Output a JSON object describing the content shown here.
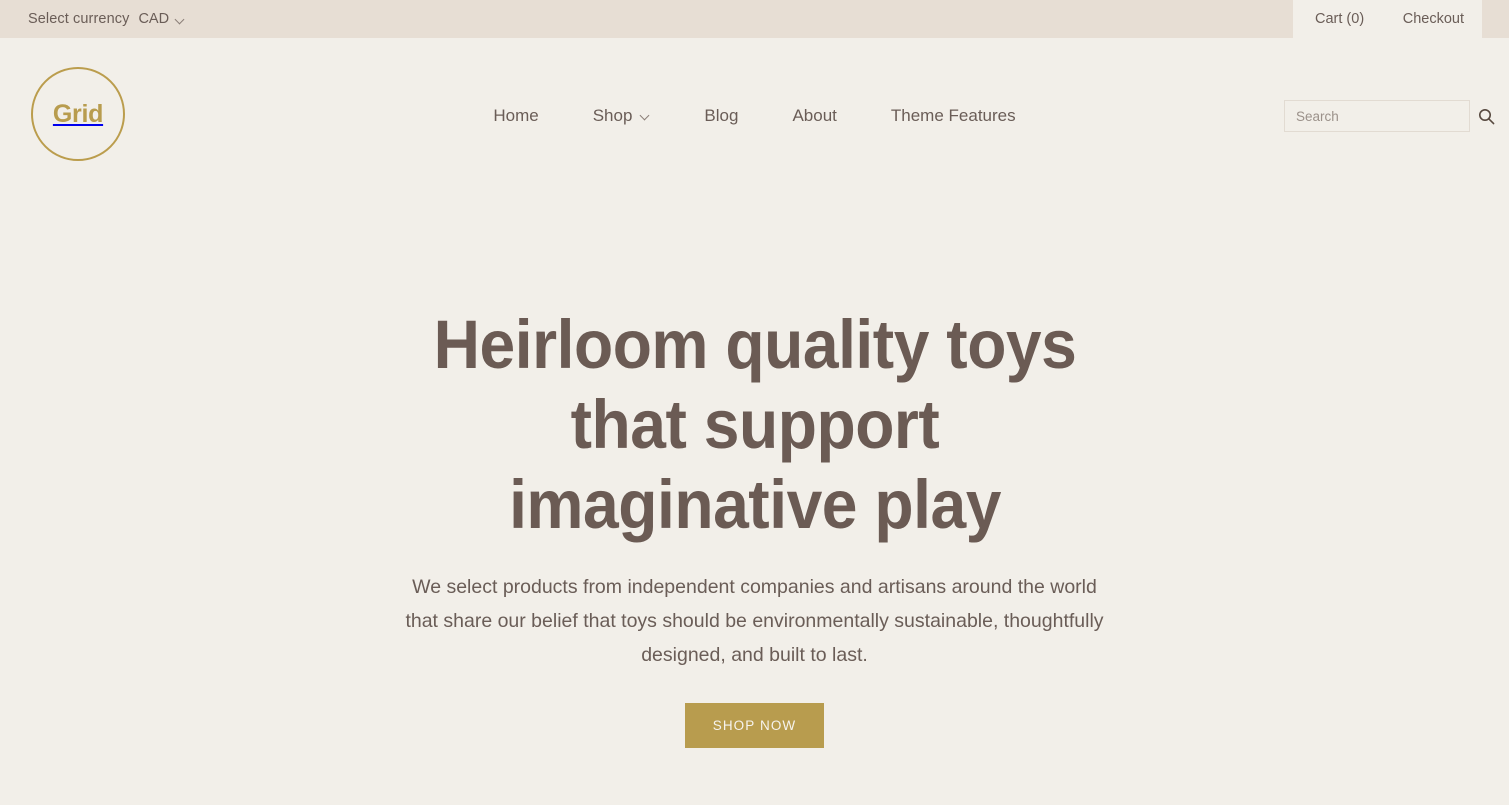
{
  "topbar": {
    "currency_label": "Select currency",
    "currency_value": "CAD",
    "cart_label": "Cart (0)",
    "checkout_label": "Checkout"
  },
  "header": {
    "logo_text": "Grid",
    "nav": [
      {
        "label": "Home",
        "has_dropdown": false
      },
      {
        "label": "Shop",
        "has_dropdown": true
      },
      {
        "label": "Blog",
        "has_dropdown": false
      },
      {
        "label": "About",
        "has_dropdown": false
      },
      {
        "label": "Theme Features",
        "has_dropdown": false
      }
    ],
    "search": {
      "value": "",
      "placeholder": "Search"
    }
  },
  "hero": {
    "title": "Heirloom quality toys that support imaginative play",
    "subtitle": "We select products from independent companies and artisans around the world that share our belief that toys should be environmentally sustainable, thoughtfully designed, and built to last.",
    "cta_label": "SHOP NOW"
  },
  "colors": {
    "page_background": "#f2efe9",
    "topbar_background": "#e7ded4",
    "accent_gold": "#b89c4e",
    "text_brown": "#6b5b54",
    "border": "#e2dbd2"
  }
}
